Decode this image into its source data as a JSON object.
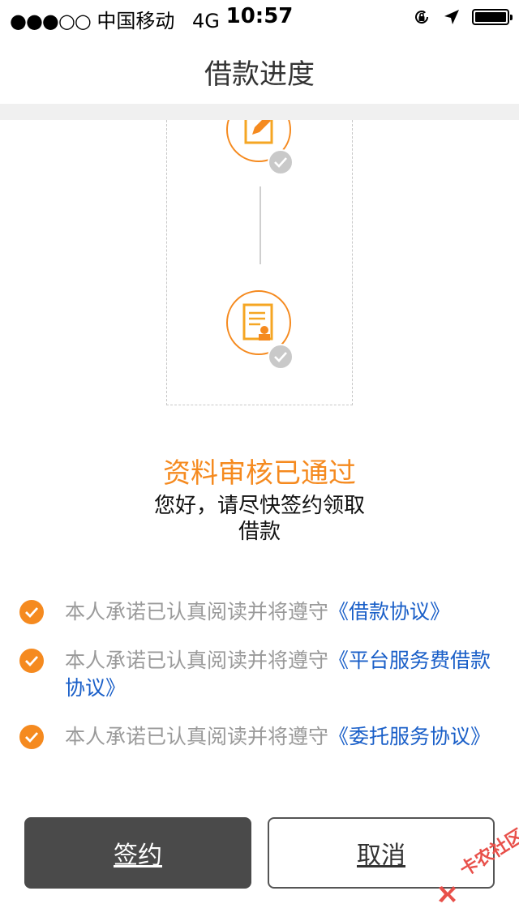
{
  "status_bar": {
    "signal": "●●●○○",
    "carrier": "中国移动",
    "network": "4G",
    "time": "10:57",
    "icons": [
      "orientation-lock-icon",
      "location-arrow-icon",
      "battery-icon"
    ],
    "battery_level": 1.0
  },
  "nav": {
    "title": "借款进度"
  },
  "timeline": {
    "steps": [
      {
        "icon": "edit-form-icon",
        "completed": true
      },
      {
        "icon": "contract-stamp-icon",
        "completed": true
      }
    ]
  },
  "status": {
    "title": "资料审核已通过",
    "message": "您好，请尽快签约领取借款"
  },
  "agreements": [
    {
      "prefix": "本人承诺已认真阅读并将遵守",
      "link": "《借款协议》",
      "checked": true
    },
    {
      "prefix": "本人承诺已认真阅读并将遵守",
      "link": "《平台服务费借款协议》",
      "checked": true
    },
    {
      "prefix": "本人承诺已认真阅读并将遵守",
      "link": "《委托服务协议》",
      "checked": true
    }
  ],
  "buttons": {
    "sign": "签约",
    "cancel": "取消"
  },
  "watermark": {
    "text": "卡农社区"
  },
  "colors": {
    "accent": "#f58a1f",
    "link": "#1a5fc8",
    "dark_button": "#4a4a4a",
    "muted_text": "#9a9a9a"
  }
}
